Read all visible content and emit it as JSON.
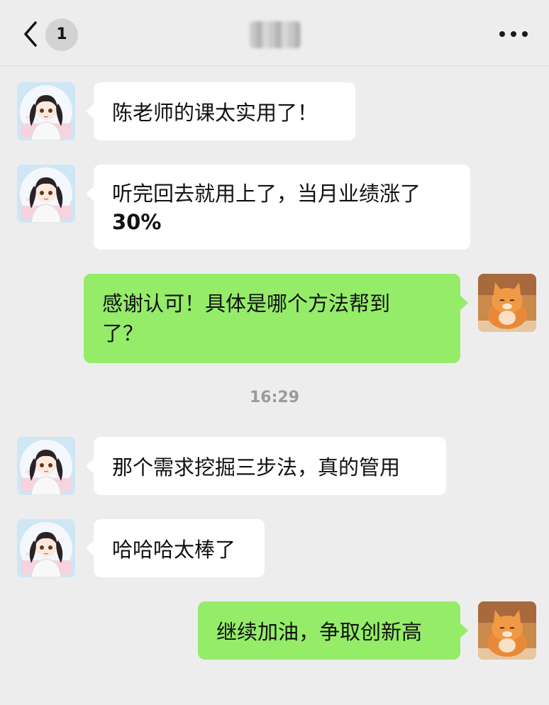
{
  "header": {
    "unread_count": "1"
  },
  "messages": [
    {
      "side": "in",
      "text": "陈老师的课太实用了！"
    },
    {
      "side": "in",
      "line1": "听完回去就用上了，当月业绩涨了",
      "line2": "30%"
    },
    {
      "side": "out",
      "line1": "感谢认可！具体是哪个方法帮到",
      "line2": "了？"
    },
    {
      "side": "in",
      "text": "那个需求挖掘三步法，真的管用"
    },
    {
      "side": "in",
      "text": "哈哈哈太棒了"
    },
    {
      "side": "out",
      "text": "继续加油，争取创新高"
    }
  ],
  "timestamp": "16:29",
  "colors": {
    "background": "#ededed",
    "incoming_bubble": "#ffffff",
    "outgoing_bubble": "#95ec69"
  },
  "icons": [
    "back-chevron-icon",
    "more-dots-icon"
  ]
}
